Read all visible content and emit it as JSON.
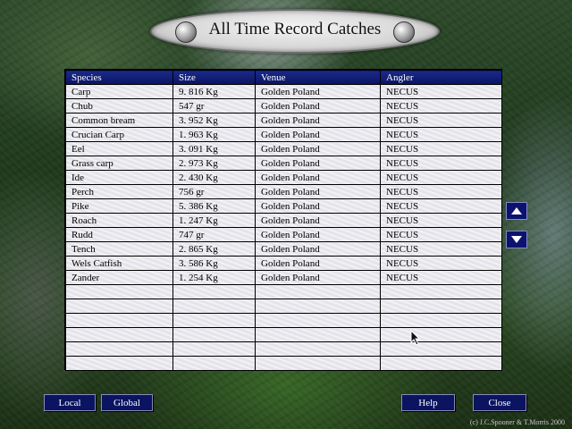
{
  "title": "All Time Record Catches",
  "columns": [
    "Species",
    "Size",
    "Venue",
    "Angler"
  ],
  "rows": [
    {
      "species": "Carp",
      "size": "9. 816 Kg",
      "venue": "Golden Poland",
      "angler": "NECUS"
    },
    {
      "species": "Chub",
      "size": "547 gr",
      "venue": "Golden Poland",
      "angler": "NECUS"
    },
    {
      "species": "Common bream",
      "size": "3. 952 Kg",
      "venue": "Golden Poland",
      "angler": "NECUS"
    },
    {
      "species": "Crucian Carp",
      "size": "1. 963 Kg",
      "venue": "Golden Poland",
      "angler": "NECUS"
    },
    {
      "species": "Eel",
      "size": "3. 091 Kg",
      "venue": "Golden Poland",
      "angler": "NECUS"
    },
    {
      "species": "Grass carp",
      "size": "2. 973 Kg",
      "venue": "Golden Poland",
      "angler": "NECUS"
    },
    {
      "species": "Ide",
      "size": "2. 430 Kg",
      "venue": "Golden Poland",
      "angler": "NECUS"
    },
    {
      "species": "Perch",
      "size": "756 gr",
      "venue": "Golden Poland",
      "angler": "NECUS"
    },
    {
      "species": "Pike",
      "size": "5. 386 Kg",
      "venue": "Golden Poland",
      "angler": "NECUS"
    },
    {
      "species": "Roach",
      "size": "1. 247 Kg",
      "venue": "Golden Poland",
      "angler": "NECUS"
    },
    {
      "species": "Rudd",
      "size": "747 gr",
      "venue": "Golden Poland",
      "angler": "NECUS"
    },
    {
      "species": "Tench",
      "size": "2. 865 Kg",
      "venue": "Golden Poland",
      "angler": "NECUS"
    },
    {
      "species": "Wels Catfish",
      "size": "3. 586 Kg",
      "venue": "Golden Poland",
      "angler": "NECUS"
    },
    {
      "species": "Zander",
      "size": "1. 254 Kg",
      "venue": "Golden Poland",
      "angler": "NECUS"
    }
  ],
  "empty_row_count": 6,
  "scroll": {
    "up_icon": "triangle-up",
    "down_icon": "triangle-down"
  },
  "buttons": {
    "local": "Local",
    "global": "Global",
    "help": "Help",
    "close": "Close"
  },
  "copyright": "(c) J.C.Spooner & T.Morris 2000",
  "colors": {
    "header_bg": "#0a1460",
    "button_bg": "#0a1460"
  }
}
